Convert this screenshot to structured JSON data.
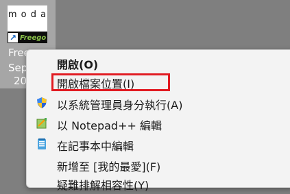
{
  "desktop_icon": {
    "thumb_logo": "m o d a",
    "freego_logo": "Freego",
    "label_lines": [
      "Free",
      "Sep",
      "20"
    ]
  },
  "context_menu": {
    "items": [
      {
        "label": "開啟(O)",
        "icon": "",
        "bold": true
      },
      {
        "label": "開啟檔案位置(I)",
        "icon": "",
        "highlighted": true
      },
      {
        "label": "以系統管理員身分執行(A)",
        "icon": "uac-shield-icon"
      },
      {
        "label": "以 Notepad++ 編輯",
        "icon": "notepad-plus-plus-icon"
      },
      {
        "label": "在記事本中編輯",
        "icon": "notepad-icon"
      },
      {
        "label": "新增至 [我的最愛](F)",
        "icon": ""
      },
      {
        "label": "疑難排解相容性(Y)",
        "icon": ""
      }
    ]
  },
  "colors": {
    "desktop": "#7f7f7f",
    "selection": "#a6a6a6",
    "menu_bg": "#f3f3f3",
    "highlight_border": "#e11b22"
  }
}
